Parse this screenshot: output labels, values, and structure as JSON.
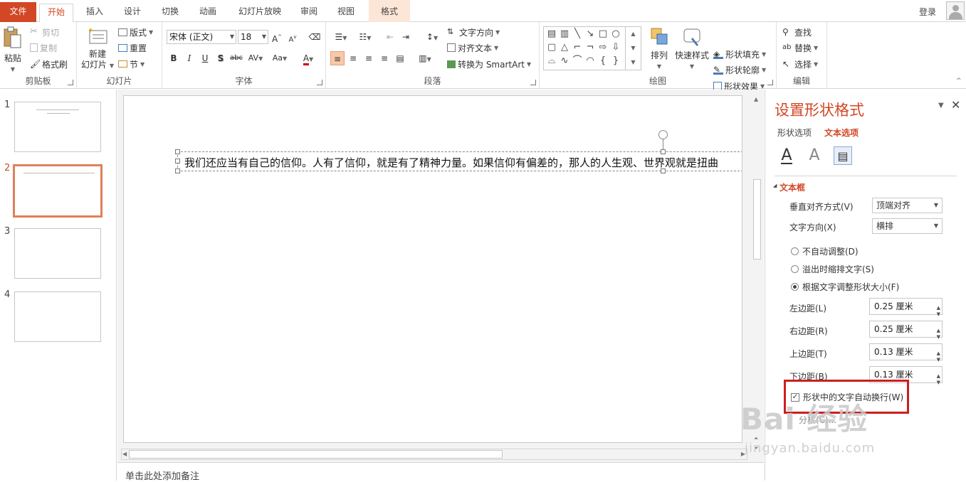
{
  "tabs": {
    "file": "文件",
    "home": "开始",
    "insert": "插入",
    "design": "设计",
    "transitions": "切换",
    "animations": "动画",
    "slideshow": "幻灯片放映",
    "review": "审阅",
    "view": "视图",
    "format": "格式"
  },
  "account": {
    "login": "登录"
  },
  "ribbon": {
    "clipboard": {
      "label": "剪贴板",
      "paste": "粘贴",
      "cut": "剪切",
      "copy": "复制",
      "format_painter": "格式刷"
    },
    "slides": {
      "label": "幻灯片",
      "new_slide_line1": "新建",
      "new_slide_line2": "幻灯片",
      "layout": "版式",
      "reset": "重置",
      "section": "节"
    },
    "font": {
      "label": "字体",
      "font_name": "宋体 (正文)",
      "font_size": "18",
      "bold": "B",
      "italic": "I",
      "underline": "U",
      "shadow": "S",
      "strike": "abc",
      "spacing": "AV",
      "case": "Aa",
      "grow": "A",
      "shrink": "A",
      "color": "A"
    },
    "paragraph": {
      "label": "段落",
      "text_direction": "文字方向",
      "align_text": "对齐文本",
      "smartart": "转换为 SmartArt"
    },
    "drawing": {
      "label": "绘图",
      "arrange": "排列",
      "quick_styles": "快速样式",
      "fill": "形状填充",
      "outline": "形状轮廓",
      "effects": "形状效果"
    },
    "editing": {
      "label": "编辑",
      "find": "查找",
      "replace": "替换",
      "select": "选择"
    }
  },
  "slides": [
    {
      "number": "1"
    },
    {
      "number": "2"
    },
    {
      "number": "3"
    },
    {
      "number": "4"
    }
  ],
  "editor": {
    "textbox_text": "我们还应当有自己的信仰。人有了信仰，就是有了精神力量。如果信仰有偏差的，那人的人生观、世界观就是扭曲",
    "notes_placeholder": "单击此处添加备注"
  },
  "format_pane": {
    "title": "设置形状格式",
    "tab_shape": "形状选项",
    "tab_text": "文本选项",
    "section": "文本框",
    "vertical_align_label": "垂直对齐方式(V)",
    "vertical_align_value": "顶端对齐",
    "text_direction_label": "文字方向(X)",
    "text_direction_value": "横排",
    "autofit_none": "不自动调整(D)",
    "autofit_shrink": "溢出时缩排文字(S)",
    "autofit_resize": "根据文字调整形状大小(F)",
    "margin_left_label": "左边距(L)",
    "margin_left_value": "0.25 厘米",
    "margin_right_label": "右边距(R)",
    "margin_right_value": "0.25 厘米",
    "margin_top_label": "上边距(T)",
    "margin_top_value": "0.13 厘米",
    "margin_bottom_label": "下边距(B)",
    "margin_bottom_value": "0.13 厘米",
    "wrap_text_label": "形状中的文字自动换行(W)",
    "columns_label": "分栏(C)..."
  },
  "watermark": {
    "logo": "Bai 经验",
    "url": "jingyan.baidu.com"
  },
  "colors": {
    "accent": "#d24726",
    "highlight": "#cc1f1f"
  }
}
